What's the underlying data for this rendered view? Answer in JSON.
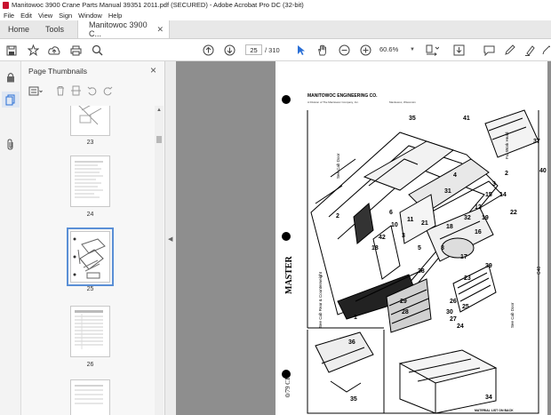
{
  "window": {
    "title": "Manitowoc 3900 Crane Parts Manual 39351 2011.pdf (SECURED) - Adobe Acrobat Pro DC (32-bit)"
  },
  "menu": [
    "File",
    "Edit",
    "View",
    "Sign",
    "Window",
    "Help"
  ],
  "tabs": {
    "home": "Home",
    "tools": "Tools",
    "document": "Manitowoc 3900 C..."
  },
  "toolbar": {
    "current_page": "25",
    "total_pages": "/ 310",
    "zoom": "60.6%"
  },
  "panel": {
    "title": "Page Thumbnails",
    "thumbnails": [
      {
        "label": "23"
      },
      {
        "label": "24"
      },
      {
        "label": "25"
      },
      {
        "label": "26"
      },
      {
        "label": ""
      }
    ],
    "selected": "25"
  },
  "document_page": {
    "header": "MANITOWOC ENGINEERING CO.",
    "subheader": "A Division of The Manitowoc Company, Inc.",
    "location": "Manitowoc, Wisconsin",
    "stamp": "MASTER",
    "callouts": {
      "cab_door_top": "See Cab Door",
      "work_head": "For Work Head",
      "cab_rear": "See Cab Rear & Counterweight",
      "cab_door_right": "See Cab Door",
      "footer_right": "MATERIAL LIST ON BACK",
      "page_code": "0/79 C1",
      "side_code": "C48"
    },
    "part_numbers": [
      "35",
      "37",
      "41",
      "40",
      "4",
      "2",
      "3",
      "15",
      "14",
      "31",
      "12",
      "6",
      "11",
      "2",
      "10",
      "42",
      "22",
      "32",
      "18",
      "19",
      "3",
      "21",
      "18",
      "16",
      "5",
      "8",
      "17",
      "38",
      "39",
      "23",
      "26",
      "1",
      "29",
      "28",
      "30",
      "27",
      "25",
      "24",
      "36",
      "34",
      "35",
      "20",
      "7",
      "9",
      "13"
    ]
  },
  "colors": {
    "accent": "#5a8fd6",
    "app_red": "#c8102e",
    "doc_bg": "#8e8e8e"
  },
  "icons": {
    "rail": [
      "lock-icon",
      "pages-icon",
      "paperclip-icon"
    ],
    "toolbar": [
      "save-icon",
      "bookmark-star-icon",
      "upload-icon",
      "print-icon",
      "search-icon",
      "prev-page-icon",
      "next-page-icon",
      "select-cursor-icon",
      "hand-icon",
      "zoom-out-icon",
      "zoom-in-icon",
      "page-layout-icon",
      "download-icon",
      "comment-icon",
      "pen-icon",
      "highlight-icon",
      "sign-icon"
    ]
  }
}
